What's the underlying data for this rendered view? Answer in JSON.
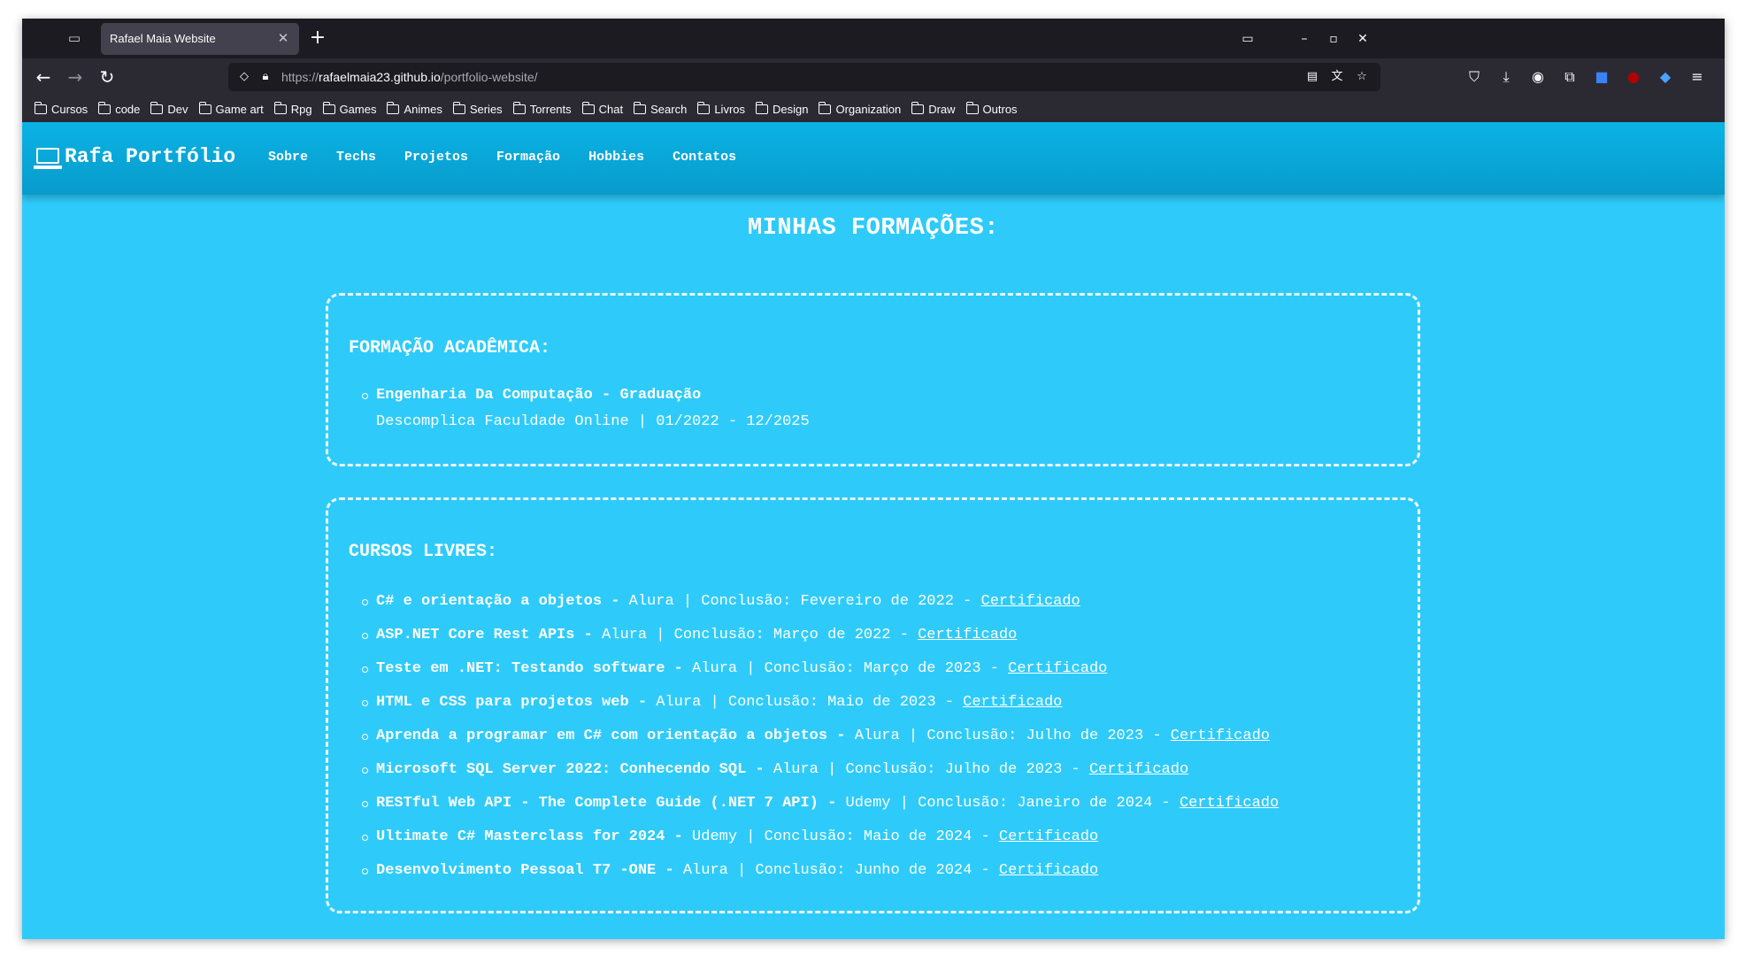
{
  "browser": {
    "tab_title": "Rafael Maia Website",
    "tab_close": "✕",
    "new_tab": "+",
    "url_prefix": "https://",
    "url_host": "rafaelmaia23.github.io",
    "url_path": "/portfolio-website/",
    "bookmarks": [
      "Cursos",
      "code",
      "Dev",
      "Game art",
      "Rpg",
      "Games",
      "Animes",
      "Series",
      "Torrents",
      "Chat",
      "Search",
      "Livros",
      "Design",
      "Organization",
      "Draw",
      "Outros"
    ]
  },
  "site": {
    "brand": "Rafa Portfólio",
    "menu": [
      "Sobre",
      "Techs",
      "Projetos",
      "Formação",
      "Hobbies",
      "Contatos"
    ],
    "page_title": "MINHAS FORMAÇÕES:",
    "academic": {
      "title": "FORMAÇÃO ACADÊMICA:",
      "degree": "Engenharia Da Computação - Graduação",
      "institution": "Descomplica Faculdade Online | 01/2022 - 12/2025"
    },
    "courses": {
      "title": "CURSOS LIVRES:",
      "items": [
        {
          "name": "C# e orientação a objetos -",
          "details": " Alura | Conclusão: Fevereiro de 2022 - ",
          "link": "Certificado"
        },
        {
          "name": "ASP.NET Core Rest APIs -",
          "details": " Alura | Conclusão: Março de 2022 - ",
          "link": "Certificado"
        },
        {
          "name": "Teste em .NET: Testando software -",
          "details": " Alura | Conclusão: Março de 2023 - ",
          "link": "Certificado"
        },
        {
          "name": "HTML e CSS para projetos web -",
          "details": " Alura | Conclusão: Maio de 2023 - ",
          "link": "Certificado"
        },
        {
          "name": "Aprenda a programar em C# com orientação a objetos -",
          "details": " Alura | Conclusão: Julho de 2023 - ",
          "link": "Certificado"
        },
        {
          "name": "Microsoft SQL Server 2022: Conhecendo SQL -",
          "details": " Alura | Conclusão: Julho de 2023 - ",
          "link": "Certificado"
        },
        {
          "name": "RESTful Web API - The Complete Guide (.NET 7 API) -",
          "details": " Udemy | Conclusão: Janeiro de 2024 - ",
          "link": "Certificado"
        },
        {
          "name": "Ultimate C# Masterclass for 2024 -",
          "details": " Udemy | Conclusão: Maio de 2024 - ",
          "link": "Certificado"
        },
        {
          "name": "Desenvolvimento Pessoal T7 -ONE -",
          "details": " Alura | Conclusão: Junho de 2024 - ",
          "link": "Certificado"
        }
      ]
    }
  }
}
